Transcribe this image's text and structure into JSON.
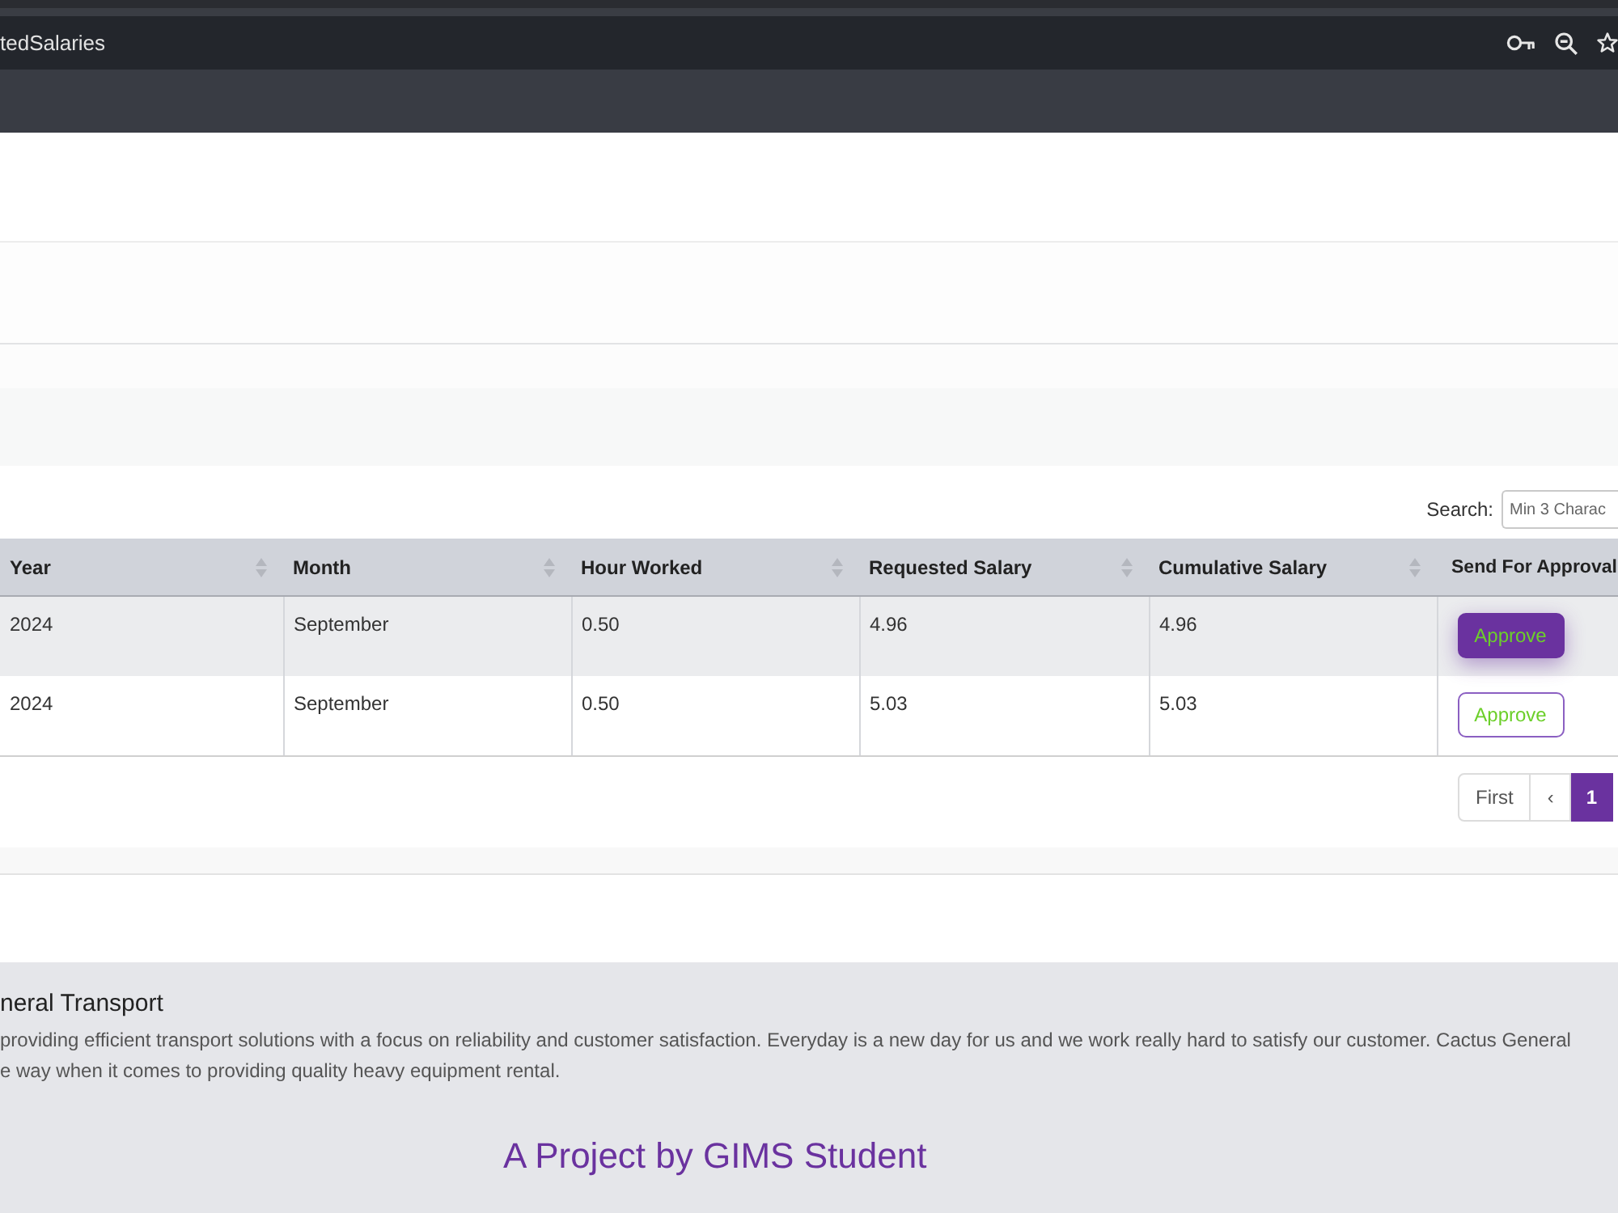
{
  "browser": {
    "tab_title": "tedSalaries"
  },
  "table": {
    "search": {
      "label": "Search:",
      "placeholder": "Min 3 Charac"
    },
    "columns": [
      {
        "label": "Year",
        "sortable": true
      },
      {
        "label": "Month",
        "sortable": true
      },
      {
        "label": "Hour Worked",
        "sortable": true
      },
      {
        "label": "Requested Salary",
        "sortable": true
      },
      {
        "label": "Cumulative Salary",
        "sortable": true
      },
      {
        "label": "Send For Approval"
      }
    ],
    "rows": [
      {
        "cells": [
          "2024",
          "September",
          "0.50",
          "4.96",
          "4.96"
        ],
        "action": {
          "label": "Approve",
          "focused": true
        }
      },
      {
        "cells": [
          "2024",
          "September",
          "0.50",
          "5.03",
          "5.03"
        ],
        "action": {
          "label": "Approve",
          "focused": false
        }
      }
    ],
    "pagination": [
      {
        "label": "First",
        "selected": false
      },
      {
        "label": "‹",
        "selected": false
      },
      {
        "label": "1",
        "selected": true
      }
    ]
  },
  "footer": {
    "title": "neral Transport",
    "description": [
      "providing efficient transport solutions with a focus on reliability and customer satisfaction. Everyday is a new day for us and we work really hard to satisfy our customer. Cactus General",
      "e way when it comes to providing quality heavy equipment rental."
    ],
    "credit": "A Project by GIMS Student"
  }
}
